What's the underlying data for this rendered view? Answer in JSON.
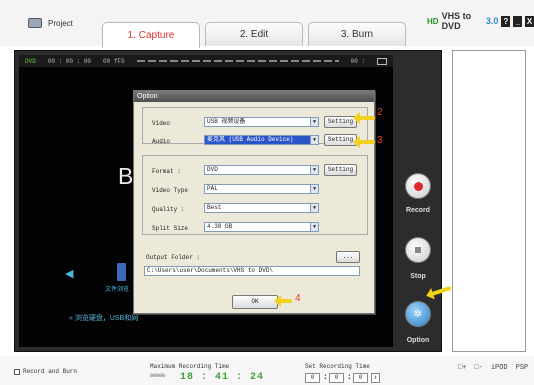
{
  "header": {
    "project_label": "Project",
    "tabs": [
      {
        "label": "1. Capture"
      },
      {
        "label": "2. Edit"
      },
      {
        "label": "3. Burn"
      }
    ],
    "brand": {
      "leaf": "HD",
      "name": "VHS to DVD",
      "version": "3.0"
    },
    "window_buttons": [
      "?",
      "_",
      "X"
    ]
  },
  "video": {
    "status": {
      "label": "DVD",
      "time": "00 : 00 : 00",
      "fps": "00 fFS",
      "right": "00 :"
    },
    "overlay_text": "Bro",
    "library_label": "文件浏览",
    "usb_text": "» 浏览硬盘，USB和网"
  },
  "controls": {
    "record_label": "Record",
    "stop_label": "Stop",
    "option_label": "Option"
  },
  "dialog": {
    "title": "Option",
    "video_label": "Video",
    "video_value": "USB 视频设备",
    "audio_label": "Audio",
    "audio_value": "麦克风 (USB Audio Device)",
    "setting_label": "Setting",
    "format_label": "Format :",
    "format_value": "DVD",
    "video_type_label": "Video Type",
    "video_type_value": "PAL",
    "quality_label": "Quality :",
    "quality_value": "Best",
    "split_size_label": "Split Size",
    "split_size_value": "4.38 GB",
    "output_folder_label": "Output Folder :",
    "browse_label": "...",
    "output_folder_value": "C:\\Users\\user\\Documents\\VHS to DVD\\",
    "ok_label": "OK"
  },
  "annotations": [
    "1",
    "2",
    "3",
    "4"
  ],
  "footer": {
    "record_and_burn_label": "Record and Burn",
    "max_recording_label": "Maximum Recording Time",
    "max_recording_small": "00000",
    "max_recording_time": "18 : 41 : 24",
    "set_recording_label": "Set Recording Time",
    "set_h": "0",
    "set_m": "0",
    "set_s": "0",
    "panel_icons": [
      "□+",
      "□-",
      "iPOD",
      "PSP"
    ]
  },
  "colors": {
    "active_tab_text": "#e0302a",
    "annotation_red": "#e83c2a",
    "annotation_arrow": "#f1d21c",
    "time_green": "#3aa33a",
    "highlight_blue": "#2a55c9"
  }
}
